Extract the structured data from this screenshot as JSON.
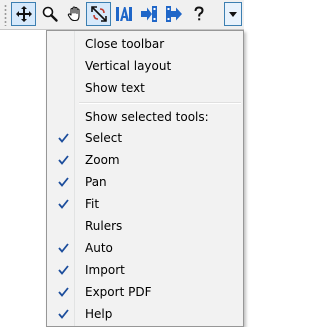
{
  "toolbar": {
    "buttons": [
      {
        "icon": "move-cross-icon",
        "name": "select"
      },
      {
        "icon": "magnifier-icon",
        "name": "zoom"
      },
      {
        "icon": "hand-icon",
        "name": "pan"
      },
      {
        "icon": "fit-icon",
        "name": "fit"
      },
      {
        "icon": "auto-a-icon",
        "name": "auto"
      },
      {
        "icon": "import-arrow-icon",
        "name": "import"
      },
      {
        "icon": "export-arrow-icon",
        "name": "export"
      },
      {
        "icon": "question-mark-icon",
        "name": "help"
      }
    ],
    "dropdown_icon": "chevron-down-icon"
  },
  "menu": {
    "top_items": [
      {
        "label": "Close toolbar"
      },
      {
        "label": "Vertical layout"
      },
      {
        "label": "Show text"
      }
    ],
    "section_header": "Show selected tools:",
    "tools": [
      {
        "label": "Select",
        "checked": true
      },
      {
        "label": "Zoom",
        "checked": true
      },
      {
        "label": "Pan",
        "checked": true
      },
      {
        "label": "Fit",
        "checked": true
      },
      {
        "label": "Rulers",
        "checked": false
      },
      {
        "label": "Auto",
        "checked": true
      },
      {
        "label": "Import",
        "checked": true
      },
      {
        "label": "Export PDF",
        "checked": true
      },
      {
        "label": "Help",
        "checked": true
      }
    ]
  },
  "colors": {
    "check": "#1c4d9c",
    "accent": "#3c7fb1",
    "icon_blue": "#1f66c8"
  }
}
